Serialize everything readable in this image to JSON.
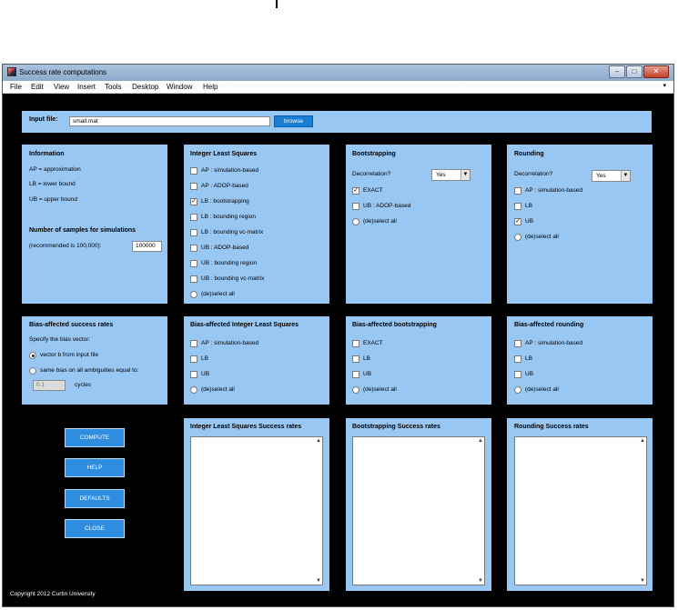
{
  "window": {
    "title": "Success rate computations",
    "minimize": "–",
    "maximize": "□",
    "close": "✕"
  },
  "menu": [
    "File",
    "Edit",
    "View",
    "Insert",
    "Tools",
    "Desktop",
    "Window",
    "Help"
  ],
  "menu_overflow": "▾",
  "input_file": {
    "label": "Input file:",
    "value": "small.mat",
    "browse": "browse"
  },
  "information": {
    "title": "Information",
    "lines": [
      "AP = approximation",
      "LB = lower bound",
      "UB = upper bound"
    ],
    "samples_title": "Number of samples for simulations",
    "samples_hint": "(recommended is 100,000):",
    "samples_value": "100000"
  },
  "ils": {
    "title": "Integer Least Squares",
    "options": [
      {
        "label": "AP : simulation-based",
        "checked": false
      },
      {
        "label": "AP : ADOP-based",
        "checked": false
      },
      {
        "label": "LB : bootstrapping",
        "checked": true
      },
      {
        "label": "LB : bounding region",
        "checked": false
      },
      {
        "label": "LB : bounding vc-matrix",
        "checked": false
      },
      {
        "label": "UB : ADOP-based",
        "checked": false
      },
      {
        "label": "UB : bounding region",
        "checked": false
      },
      {
        "label": "UB : bounding vc-matrix",
        "checked": false
      }
    ],
    "select_all": "(de)select all"
  },
  "bootstrapping": {
    "title": "Bootstrapping",
    "decorrelation_label": "Decorrelation?",
    "decorrelation_value": "Yes",
    "options": [
      {
        "label": "EXACT",
        "checked": true
      },
      {
        "label": "UB : ADOP-based",
        "checked": false
      }
    ],
    "select_all": "(de)select all"
  },
  "rounding": {
    "title": "Rounding",
    "decorrelation_label": "Decorrelation?",
    "decorrelation_value": "Yes",
    "options": [
      {
        "label": "AP : simulation-based",
        "checked": false
      },
      {
        "label": "LB",
        "checked": false
      },
      {
        "label": "UB",
        "checked": true
      }
    ],
    "select_all": "(de)select all"
  },
  "bias": {
    "title": "Bias-affected success rates",
    "specify": "Specify the bias vector:",
    "opt1": "vector b from input file",
    "opt2": "same bias on all ambiguities equal to:",
    "value": "0.1",
    "unit": "cycles"
  },
  "bias_ils": {
    "title": "Bias-affected Integer Least Squares",
    "options": [
      {
        "label": "AP : simulation-based"
      },
      {
        "label": "LB"
      },
      {
        "label": "UB"
      }
    ],
    "select_all": "(de)select all"
  },
  "bias_boot": {
    "title": "Bias-affected bootstrapping",
    "options": [
      {
        "label": "EXACT"
      },
      {
        "label": "LB"
      },
      {
        "label": "UB"
      }
    ],
    "select_all": "(de)select all"
  },
  "bias_round": {
    "title": "Bias-affected rounding",
    "options": [
      {
        "label": "AP : simulation-based"
      },
      {
        "label": "LB"
      },
      {
        "label": "UB"
      }
    ],
    "select_all": "(de)select all"
  },
  "buttons": {
    "compute": "COMPUTE",
    "help": "HELP",
    "defaults": "DEFAULTS",
    "close": "CLOSE"
  },
  "results": {
    "ils_title": "Integer Least Squares Success rates",
    "boot_title": "Bootstrapping Success rates",
    "round_title": "Rounding Success rates",
    "up": "▲",
    "down": "▼"
  },
  "copyright": "Copyright 2012 Curtin University",
  "colors": {
    "panel": "#99c7f4",
    "window_bg": "#000000",
    "button": "#2f8ddf"
  }
}
